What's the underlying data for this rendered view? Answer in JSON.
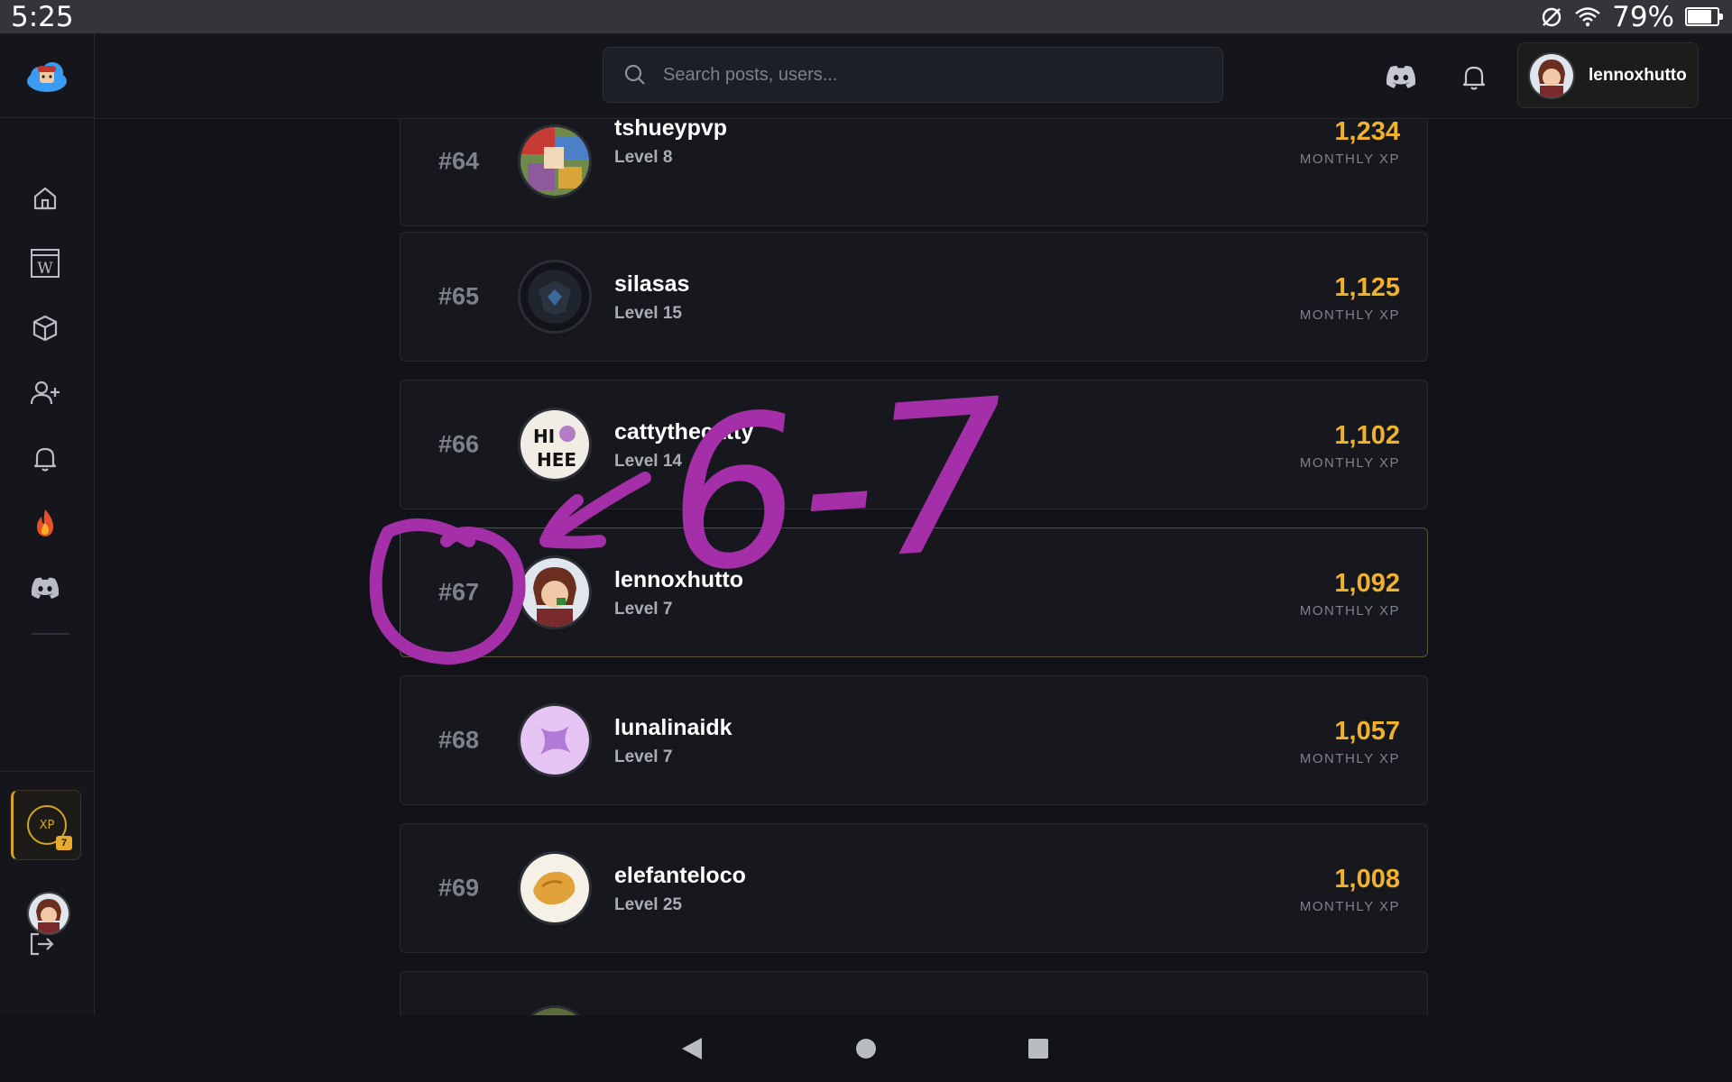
{
  "status_bar": {
    "time": "5:25",
    "battery_percent": "79%",
    "icons": [
      "alarm-off-icon",
      "wifi-icon",
      "battery-icon"
    ]
  },
  "sidebar": {
    "logo": "cloud-mascot-logo",
    "nav_items": [
      {
        "name": "home",
        "icon": "home-icon"
      },
      {
        "name": "wiki",
        "icon": "wiki-icon",
        "glyph": "W"
      },
      {
        "name": "items",
        "icon": "cube-icon"
      },
      {
        "name": "add-friend",
        "icon": "user-plus-icon"
      },
      {
        "name": "notifications",
        "icon": "bell-icon"
      },
      {
        "name": "trending",
        "icon": "fire-icon"
      },
      {
        "name": "discord",
        "icon": "discord-icon"
      }
    ],
    "xp_widget": {
      "label": "XP",
      "level": "7"
    },
    "logout_icon": "logout-icon"
  },
  "header": {
    "search": {
      "placeholder": "Search posts, users..."
    },
    "user": {
      "name": "lennoxhutto"
    }
  },
  "leaderboard": {
    "rows": [
      {
        "rank": "#64",
        "name": "tshueypvp",
        "level": "Level 8",
        "xp": "1,234",
        "xp_label": "MONTHLY XP"
      },
      {
        "rank": "#65",
        "name": "silasas",
        "level": "Level 15",
        "xp": "1,125",
        "xp_label": "MONTHLY XP"
      },
      {
        "rank": "#66",
        "name": "cattythecatty",
        "level": "Level 14",
        "xp": "1,102",
        "xp_label": "MONTHLY XP"
      },
      {
        "rank": "#67",
        "name": "lennoxhutto",
        "level": "Level 7",
        "xp": "1,092",
        "xp_label": "MONTHLY XP"
      },
      {
        "rank": "#68",
        "name": "lunalinaidk",
        "level": "Level 7",
        "xp": "1,057",
        "xp_label": "MONTHLY XP"
      },
      {
        "rank": "#69",
        "name": "elefanteloco",
        "level": "Level 25",
        "xp": "1,008",
        "xp_label": "MONTHLY XP"
      }
    ]
  },
  "annotation": {
    "text": "6-7",
    "color": "#a52fa8"
  },
  "colors": {
    "accent_xp": "#f0b12c",
    "background": "#111318",
    "card": "#16181d"
  }
}
